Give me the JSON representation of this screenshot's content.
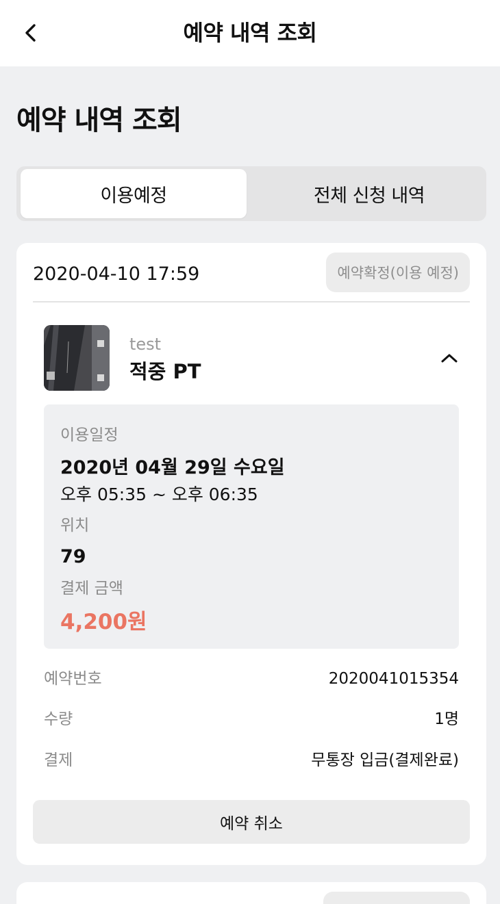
{
  "header": {
    "back_icon": "chevron-left-icon",
    "title": "예약 내역 조회"
  },
  "page": {
    "title": "예약 내역 조회"
  },
  "tabs": [
    {
      "label": "이용예정",
      "active": true
    },
    {
      "label": "전체 신청 내역",
      "active": false
    }
  ],
  "reservation": {
    "datetime": "2020-04-10 17:59",
    "status": "예약확정(이용 예정)",
    "product": {
      "subtitle": "test",
      "name": "적중 PT",
      "toggle_icon": "chevron-up-icon"
    },
    "detail": {
      "schedule_label": "이용일정",
      "schedule_date": "2020년 04월 29일 수요일",
      "schedule_time": "오후 05:35 ~ 오후 06:35",
      "location_label": "위치",
      "location_value": "79",
      "price_label": "결제 금액",
      "price_value": "4,200원",
      "price_color": "#ea7562"
    },
    "info": [
      {
        "label": "예약번호",
        "value": "2020041015354"
      },
      {
        "label": "수량",
        "value": "1명"
      },
      {
        "label": "결제",
        "value": "무통장 입금(결제완료)"
      }
    ],
    "cancel_label": "예약 취소"
  }
}
